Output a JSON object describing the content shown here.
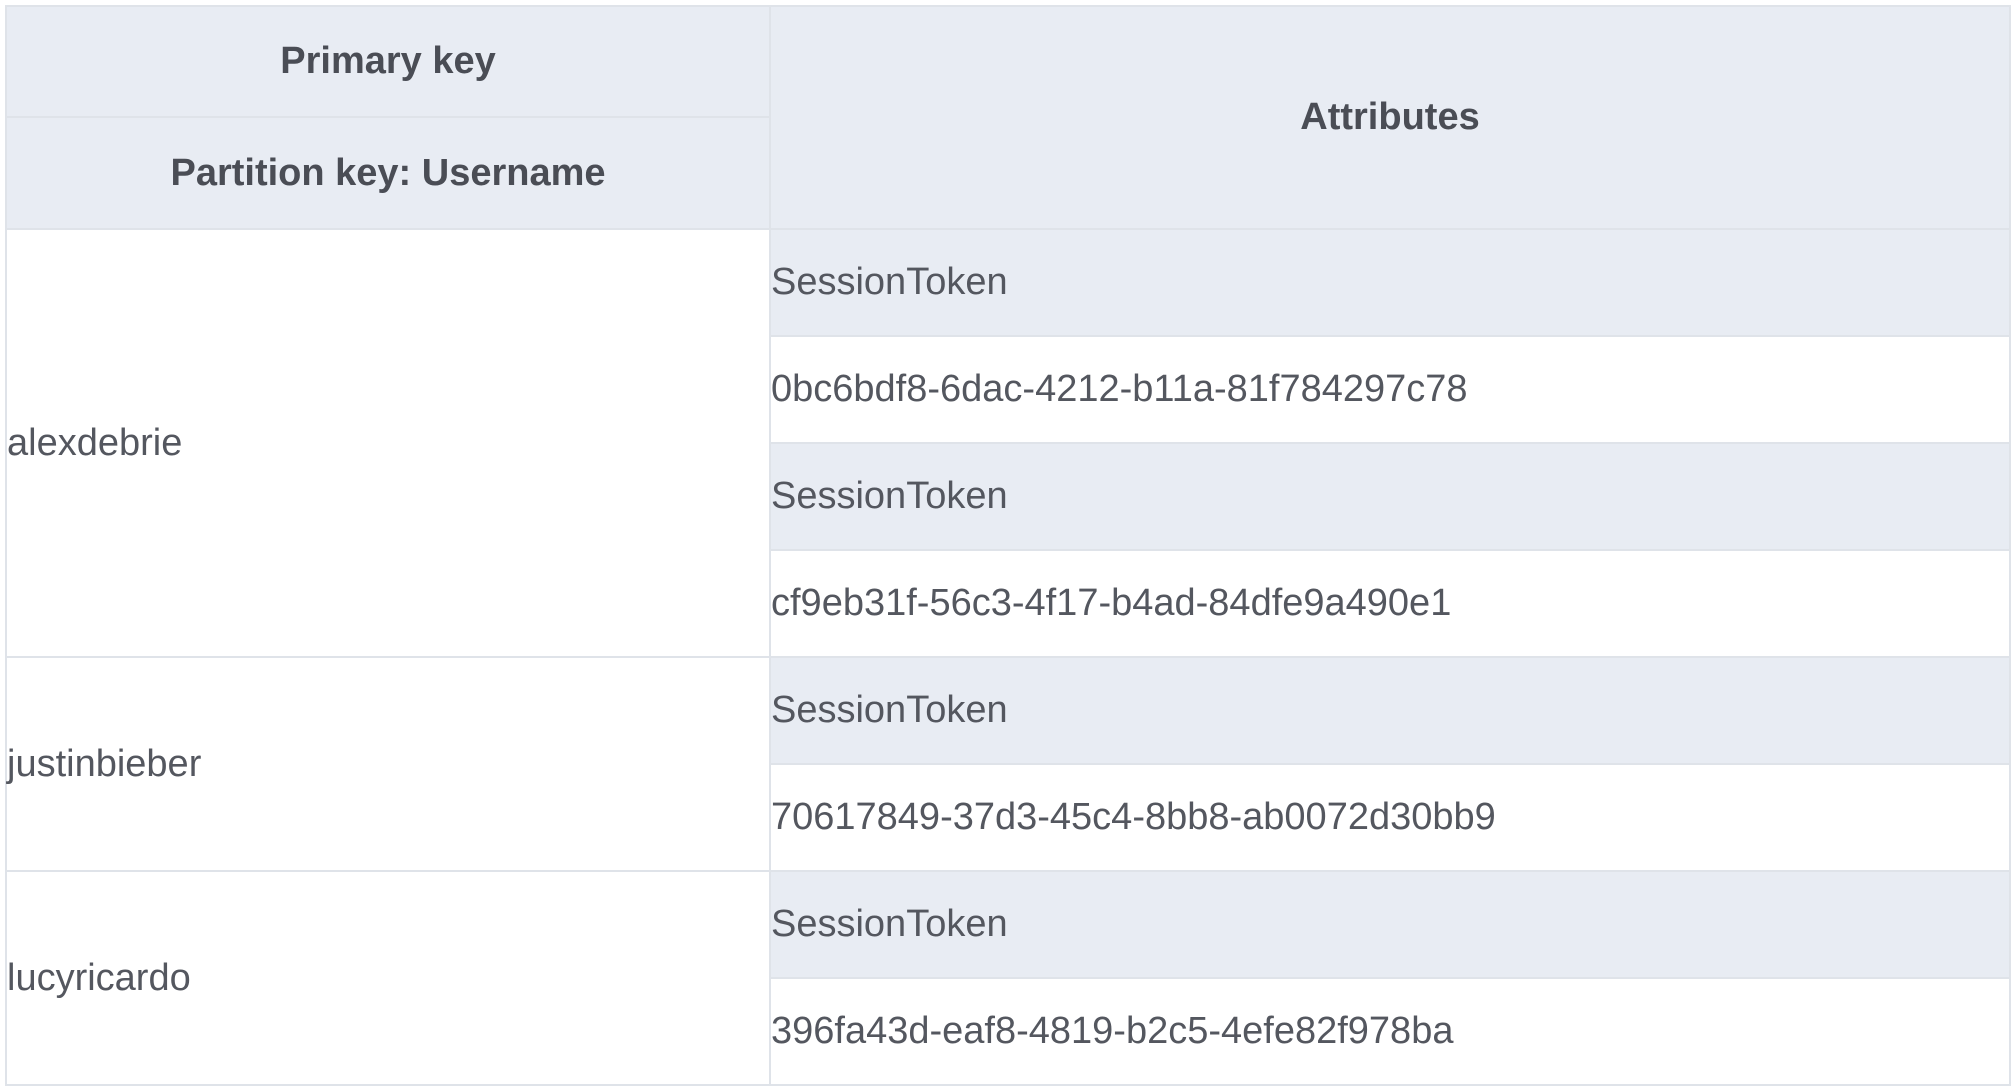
{
  "table": {
    "header": {
      "primary_key": "Primary key",
      "partition_key": "Partition key: Username",
      "attributes": "Attributes"
    },
    "items": [
      {
        "username": "alexdebrie",
        "attributes": [
          {
            "name": "SessionToken",
            "value": "0bc6bdf8-6dac-4212-b11a-81f784297c78"
          },
          {
            "name": "SessionToken",
            "value": "cf9eb31f-56c3-4f17-b4ad-84dfe9a490e1"
          }
        ]
      },
      {
        "username": "justinbieber",
        "attributes": [
          {
            "name": "SessionToken",
            "value": "70617849-37d3-45c4-8bb8-ab0072d30bb9"
          }
        ]
      },
      {
        "username": "lucyricardo",
        "attributes": [
          {
            "name": "SessionToken",
            "value": "396fa43d-eaf8-4819-b2c5-4efe82f978ba"
          }
        ]
      }
    ]
  },
  "colors": {
    "header_bg": "#e8ecf3",
    "border": "#dfe3e9",
    "header_text": "#4a4d55",
    "body_text": "#54575f"
  }
}
